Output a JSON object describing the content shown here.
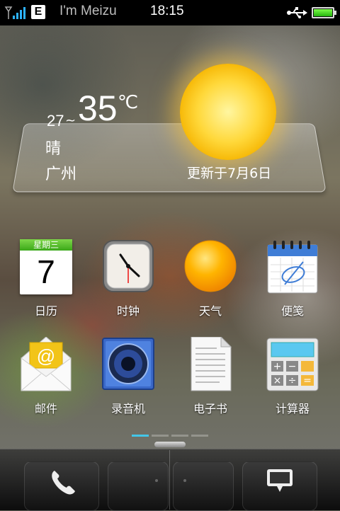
{
  "status_bar": {
    "network_badge": "E",
    "carrier": "I'm Meizu",
    "time": "18:15",
    "battery_level": 1.0,
    "icons": [
      "signal-icon",
      "usb-icon",
      "battery-icon"
    ]
  },
  "weather": {
    "low": "27",
    "separator": "~",
    "high": "35",
    "unit": "℃",
    "condition": "晴",
    "city": "广州",
    "updated": "更新于7月6日",
    "icon": "sun-icon"
  },
  "apps": [
    {
      "label": "日历",
      "icon": "calendar-icon",
      "calendar_header": "星期三",
      "calendar_day": "7"
    },
    {
      "label": "时钟",
      "icon": "clock-icon"
    },
    {
      "label": "天气",
      "icon": "weather-icon"
    },
    {
      "label": "便笺",
      "icon": "notepad-icon"
    },
    {
      "label": "邮件",
      "icon": "email-icon"
    },
    {
      "label": "录音机",
      "icon": "recorder-icon"
    },
    {
      "label": "电子书",
      "icon": "ebook-icon"
    },
    {
      "label": "计算器",
      "icon": "calculator-icon"
    }
  ],
  "page_indicator": {
    "pages": 4,
    "current": 1
  },
  "dock": {
    "icons": [
      "phone-icon",
      "message-icon"
    ]
  },
  "colors": {
    "accent": "#43c6e8",
    "battery": "#3dd61e",
    "calendar_green": "#5cc230"
  }
}
